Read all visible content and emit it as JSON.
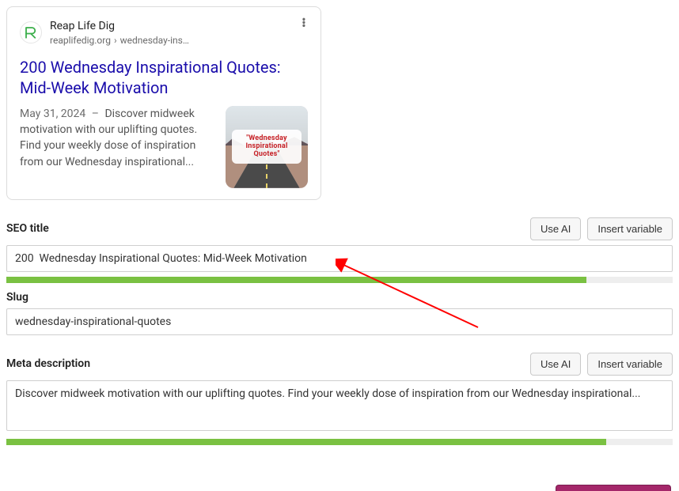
{
  "preview": {
    "site_name": "Reap Life Dig",
    "domain": "reaplifedig.org",
    "path": "wednesday-ins…",
    "title": "200 Wednesday Inspirational Quotes: Mid-Week Motivation",
    "date": "May 31, 2024",
    "snippet": "Discover midweek motivation with our uplifting quotes. Find your weekly dose of inspiration from our Wednesday inspirational...",
    "thumb_caption": "\"Wednesday Inspirational Quotes\""
  },
  "seo_title": {
    "label": "SEO title",
    "value": "200  Wednesday Inspirational Quotes: Mid-Week Motivation",
    "use_ai": "Use AI",
    "insert_var": "Insert variable",
    "progress_pct": 87
  },
  "slug": {
    "label": "Slug",
    "value": "wednesday-inspirational-quotes"
  },
  "meta": {
    "label": "Meta description",
    "value": "Discover midweek motivation with our uplifting quotes. Find your weekly dose of inspiration from our Wednesday inspirational...",
    "use_ai": "Use AI",
    "insert_var": "Insert variable",
    "progress_pct": 90
  }
}
